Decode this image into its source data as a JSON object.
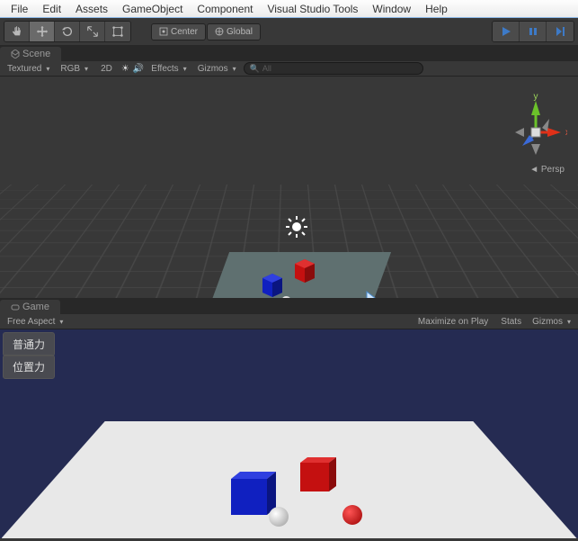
{
  "menu": {
    "items": [
      "File",
      "Edit",
      "Assets",
      "GameObject",
      "Component",
      "Visual Studio Tools",
      "Window",
      "Help"
    ]
  },
  "toolbar": {
    "pivot1": "Center",
    "pivot2": "Global"
  },
  "scene": {
    "tab_label": "Scene",
    "shaded": "Textured",
    "render_mode": "RGB",
    "dim": "2D",
    "effects": "Effects",
    "gizmos": "Gizmos",
    "search_placeholder": "All",
    "orientation": "Persp"
  },
  "game": {
    "tab_label": "Game",
    "aspect": "Free Aspect",
    "maximize": "Maximize on Play",
    "stats": "Stats",
    "gizmos": "Gizmos",
    "buttons": [
      "普通力",
      "位置力"
    ]
  },
  "colors": {
    "cube_red": "#c41010",
    "cube_red_side": "#8a0c0c",
    "cube_red_top": "#e03030",
    "cube_blue": "#1020c0",
    "cube_blue_side": "#0a1580",
    "cube_blue_top": "#3040e0",
    "play_icon": "#3d7ac7"
  }
}
